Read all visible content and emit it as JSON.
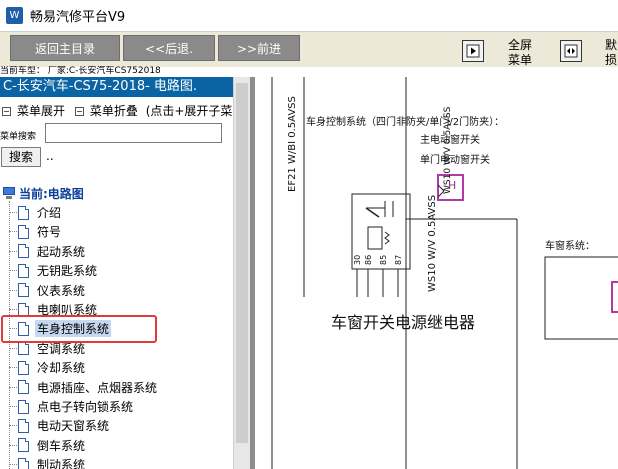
{
  "window": {
    "title": "畅易汽修平台V9",
    "icon_text": "W"
  },
  "toolbar": {
    "back_home": "返回主目录",
    "prev": "<<后退.",
    "next": ">>前进",
    "fullscreen_line1": "全屏",
    "fullscreen_line2": "菜单",
    "right_cut_line1": "默",
    "right_cut_line2": "损"
  },
  "vehicle_info": "当前车型：  厂家:C-长安汽车CS752018",
  "sidebar": {
    "path": "C-长安汽车-CS75-2018- 电路图.",
    "expand_label": "菜单展开",
    "collapse_label": "菜单折叠",
    "hint": "(点击+展开子菜",
    "search_label": "菜单搜索",
    "search_value": "",
    "search_button": "搜索",
    "dots": "..",
    "current_label": "当前:电路图",
    "items": [
      "介绍",
      "符号",
      "起动系统",
      "无钥匙系统",
      "仪表系统",
      "电喇叭系统",
      "车身控制系统",
      "空调系统",
      "冷却系统",
      "电源插座、点烟器系统",
      "点电子转向锁系统",
      "电动天窗系统",
      "倒车系统",
      "制动系统"
    ],
    "selected_index": 6
  },
  "diagram": {
    "title": "车身控制系统（四门非防夹/单门/2门防夹）：",
    "sub1": "主电动窗开关",
    "sub2": "单门电动窗开关",
    "wire_top": "EF21 W/BI 0.5AVSS",
    "wire_relay": "WS10 W/V 0.5AVSS",
    "pins": [
      "30",
      "86",
      "85",
      "87"
    ],
    "relay_label": "车窗开关电源继电器",
    "window_sys_label": "车窗系统：",
    "pin_h": "H",
    "colors": {
      "pink_box": "#b03aa6",
      "selection_red": "#e23a3a",
      "path_bar": "#0a64a4"
    }
  }
}
